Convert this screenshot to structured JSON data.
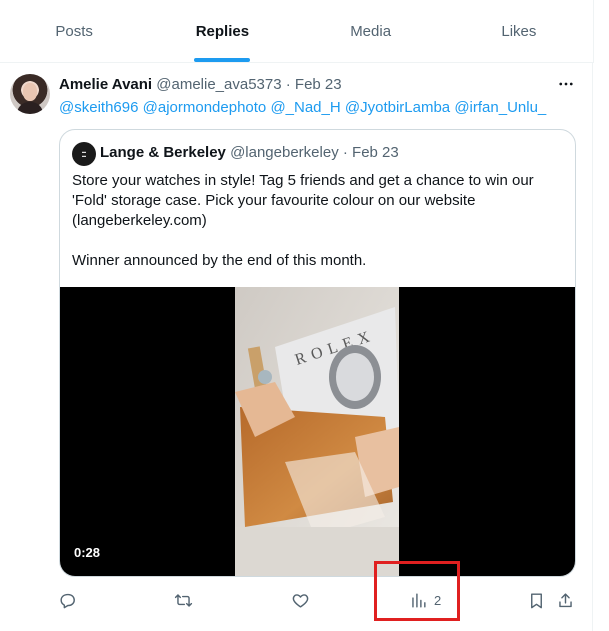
{
  "tabs": [
    {
      "label": "Posts",
      "active": false
    },
    {
      "label": "Replies",
      "active": true
    },
    {
      "label": "Media",
      "active": false
    },
    {
      "label": "Likes",
      "active": false
    }
  ],
  "post": {
    "author_name": "Amelie Avani",
    "author_handle": "@amelie_ava5373",
    "separator": " · ",
    "date": "Feb 23",
    "mentions": [
      "@skeith696",
      "@ajormondephoto",
      "@_Nad_H",
      "@JyotbirLamba",
      "@irfan_Unlu_"
    ]
  },
  "quote": {
    "author_name": "Lange & Berkeley",
    "author_handle": "@langeberkeley",
    "date": "Feb 23",
    "text_line1": "Store your watches in style! Tag 5 friends and get a chance to win our 'Fold' storage case. Pick your favourite colour on our website (langeberkeley.com)",
    "text_line2": "Winner announced by the end of this month.",
    "video_duration": "0:28",
    "video_frame_text": "ROLEX"
  },
  "actions": {
    "views_count": "2"
  },
  "colors": {
    "accent": "#1d9bf0",
    "secondary_text": "#536471",
    "highlight": "#e02020"
  },
  "icons": [
    "more-icon",
    "reply-icon",
    "retweet-icon",
    "like-icon",
    "views-icon",
    "bookmark-icon",
    "share-icon"
  ]
}
